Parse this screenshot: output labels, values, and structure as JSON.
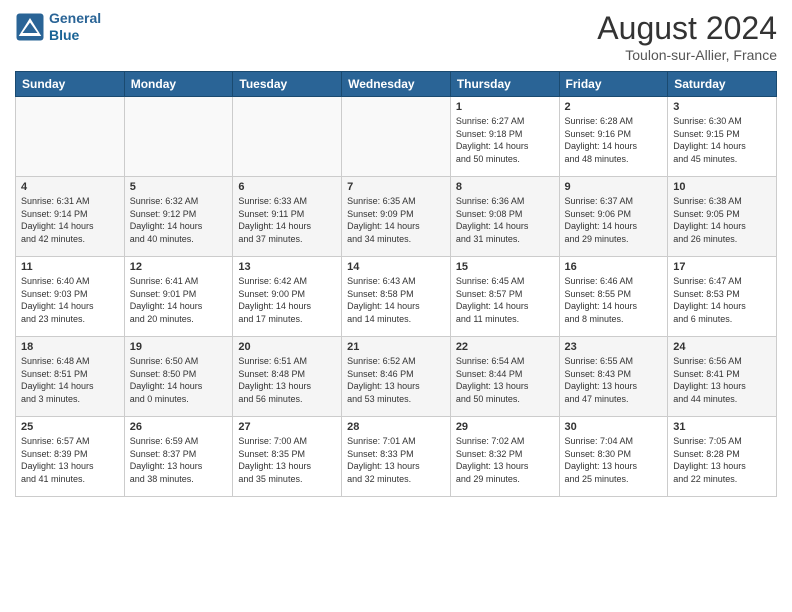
{
  "header": {
    "logo_line1": "General",
    "logo_line2": "Blue",
    "main_title": "August 2024",
    "subtitle": "Toulon-sur-Allier, France"
  },
  "days_of_week": [
    "Sunday",
    "Monday",
    "Tuesday",
    "Wednesday",
    "Thursday",
    "Friday",
    "Saturday"
  ],
  "weeks": [
    {
      "cells": [
        {
          "date": "",
          "text": ""
        },
        {
          "date": "",
          "text": ""
        },
        {
          "date": "",
          "text": ""
        },
        {
          "date": "",
          "text": ""
        },
        {
          "date": "1",
          "text": "Sunrise: 6:27 AM\nSunset: 9:18 PM\nDaylight: 14 hours\nand 50 minutes."
        },
        {
          "date": "2",
          "text": "Sunrise: 6:28 AM\nSunset: 9:16 PM\nDaylight: 14 hours\nand 48 minutes."
        },
        {
          "date": "3",
          "text": "Sunrise: 6:30 AM\nSunset: 9:15 PM\nDaylight: 14 hours\nand 45 minutes."
        }
      ]
    },
    {
      "cells": [
        {
          "date": "4",
          "text": "Sunrise: 6:31 AM\nSunset: 9:14 PM\nDaylight: 14 hours\nand 42 minutes."
        },
        {
          "date": "5",
          "text": "Sunrise: 6:32 AM\nSunset: 9:12 PM\nDaylight: 14 hours\nand 40 minutes."
        },
        {
          "date": "6",
          "text": "Sunrise: 6:33 AM\nSunset: 9:11 PM\nDaylight: 14 hours\nand 37 minutes."
        },
        {
          "date": "7",
          "text": "Sunrise: 6:35 AM\nSunset: 9:09 PM\nDaylight: 14 hours\nand 34 minutes."
        },
        {
          "date": "8",
          "text": "Sunrise: 6:36 AM\nSunset: 9:08 PM\nDaylight: 14 hours\nand 31 minutes."
        },
        {
          "date": "9",
          "text": "Sunrise: 6:37 AM\nSunset: 9:06 PM\nDaylight: 14 hours\nand 29 minutes."
        },
        {
          "date": "10",
          "text": "Sunrise: 6:38 AM\nSunset: 9:05 PM\nDaylight: 14 hours\nand 26 minutes."
        }
      ]
    },
    {
      "cells": [
        {
          "date": "11",
          "text": "Sunrise: 6:40 AM\nSunset: 9:03 PM\nDaylight: 14 hours\nand 23 minutes."
        },
        {
          "date": "12",
          "text": "Sunrise: 6:41 AM\nSunset: 9:01 PM\nDaylight: 14 hours\nand 20 minutes."
        },
        {
          "date": "13",
          "text": "Sunrise: 6:42 AM\nSunset: 9:00 PM\nDaylight: 14 hours\nand 17 minutes."
        },
        {
          "date": "14",
          "text": "Sunrise: 6:43 AM\nSunset: 8:58 PM\nDaylight: 14 hours\nand 14 minutes."
        },
        {
          "date": "15",
          "text": "Sunrise: 6:45 AM\nSunset: 8:57 PM\nDaylight: 14 hours\nand 11 minutes."
        },
        {
          "date": "16",
          "text": "Sunrise: 6:46 AM\nSunset: 8:55 PM\nDaylight: 14 hours\nand 8 minutes."
        },
        {
          "date": "17",
          "text": "Sunrise: 6:47 AM\nSunset: 8:53 PM\nDaylight: 14 hours\nand 6 minutes."
        }
      ]
    },
    {
      "cells": [
        {
          "date": "18",
          "text": "Sunrise: 6:48 AM\nSunset: 8:51 PM\nDaylight: 14 hours\nand 3 minutes."
        },
        {
          "date": "19",
          "text": "Sunrise: 6:50 AM\nSunset: 8:50 PM\nDaylight: 14 hours\nand 0 minutes."
        },
        {
          "date": "20",
          "text": "Sunrise: 6:51 AM\nSunset: 8:48 PM\nDaylight: 13 hours\nand 56 minutes."
        },
        {
          "date": "21",
          "text": "Sunrise: 6:52 AM\nSunset: 8:46 PM\nDaylight: 13 hours\nand 53 minutes."
        },
        {
          "date": "22",
          "text": "Sunrise: 6:54 AM\nSunset: 8:44 PM\nDaylight: 13 hours\nand 50 minutes."
        },
        {
          "date": "23",
          "text": "Sunrise: 6:55 AM\nSunset: 8:43 PM\nDaylight: 13 hours\nand 47 minutes."
        },
        {
          "date": "24",
          "text": "Sunrise: 6:56 AM\nSunset: 8:41 PM\nDaylight: 13 hours\nand 44 minutes."
        }
      ]
    },
    {
      "cells": [
        {
          "date": "25",
          "text": "Sunrise: 6:57 AM\nSunset: 8:39 PM\nDaylight: 13 hours\nand 41 minutes."
        },
        {
          "date": "26",
          "text": "Sunrise: 6:59 AM\nSunset: 8:37 PM\nDaylight: 13 hours\nand 38 minutes."
        },
        {
          "date": "27",
          "text": "Sunrise: 7:00 AM\nSunset: 8:35 PM\nDaylight: 13 hours\nand 35 minutes."
        },
        {
          "date": "28",
          "text": "Sunrise: 7:01 AM\nSunset: 8:33 PM\nDaylight: 13 hours\nand 32 minutes."
        },
        {
          "date": "29",
          "text": "Sunrise: 7:02 AM\nSunset: 8:32 PM\nDaylight: 13 hours\nand 29 minutes."
        },
        {
          "date": "30",
          "text": "Sunrise: 7:04 AM\nSunset: 8:30 PM\nDaylight: 13 hours\nand 25 minutes."
        },
        {
          "date": "31",
          "text": "Sunrise: 7:05 AM\nSunset: 8:28 PM\nDaylight: 13 hours\nand 22 minutes."
        }
      ]
    }
  ]
}
